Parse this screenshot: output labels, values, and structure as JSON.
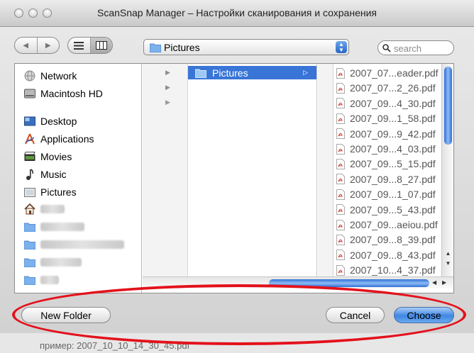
{
  "window": {
    "title": "ScanSnap Manager – Настройки сканирования и сохранения"
  },
  "toolbar": {
    "back_icon": "chevron-left-icon",
    "forward_icon": "chevron-right-icon",
    "view_list_icon": "list-view-icon",
    "view_column_icon": "column-view-icon",
    "path_popup": {
      "value": "Pictures",
      "icon": "folder-icon"
    },
    "search": {
      "placeholder": "search",
      "icon": "magnifier-icon"
    }
  },
  "sidebar": {
    "devices": [
      {
        "label": "Network",
        "icon": "network-icon"
      },
      {
        "label": "Macintosh HD",
        "icon": "hard-disk-icon"
      }
    ],
    "places": [
      {
        "label": "Desktop",
        "icon": "desktop-icon"
      },
      {
        "label": "Applications",
        "icon": "applications-icon"
      },
      {
        "label": "Movies",
        "icon": "movies-icon"
      },
      {
        "label": "Music",
        "icon": "music-icon"
      },
      {
        "label": "Pictures",
        "icon": "pictures-icon"
      }
    ]
  },
  "column_selected": {
    "label": "Pictures"
  },
  "files": [
    "2007_07...eader.pdf",
    "2007_07...2_26.pdf",
    "2007_09...4_30.pdf",
    "2007_09...1_58.pdf",
    "2007_09...9_42.pdf",
    "2007_09...4_03.pdf",
    "2007_09...5_15.pdf",
    "2007_09...8_27.pdf",
    "2007_09...1_07.pdf",
    "2007_09...5_43.pdf",
    "2007_09...aeiou.pdf",
    "2007_09...8_39.pdf",
    "2007_09...8_43.pdf",
    "2007_10...4_37.pdf"
  ],
  "buttons": {
    "new_folder": "New Folder",
    "cancel": "Cancel",
    "choose": "Choose"
  },
  "behind": {
    "example_text": "пример: 2007_10_10_14_30_45.pdf"
  },
  "colors": {
    "selection": "#3875d7",
    "highlight_ellipse": "#e3111b"
  }
}
